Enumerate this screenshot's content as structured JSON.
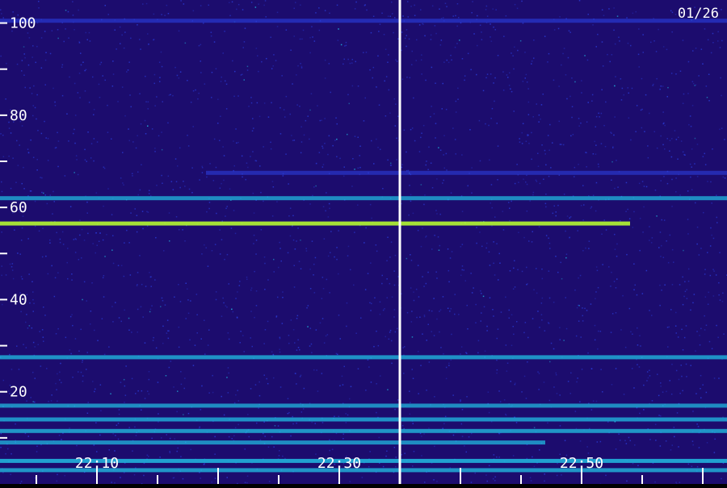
{
  "date_label": "01/26",
  "colors": {
    "background": "#1c0c6e",
    "tick": "#ffffff",
    "label": "#ffffff",
    "weak": "#2a3cd8",
    "medium": "#21c3e6",
    "strong": "#b8ff30",
    "peak": "#ff9a2a"
  },
  "chart_data": {
    "type": "heatmap",
    "title": "",
    "xlabel": "",
    "ylabel": "",
    "x_time_range": [
      "22:02",
      "22:62"
    ],
    "x_ticks": [
      "22:10",
      "22:30",
      "22:50"
    ],
    "y_ticks": [
      20,
      40,
      60,
      80,
      100
    ],
    "ylim": [
      0,
      105
    ],
    "marker_time": "22:35",
    "bands": [
      {
        "y": 56.5,
        "from": "22:02",
        "to": "22:54",
        "intensity": 0.85
      },
      {
        "y": 62.0,
        "from": "22:02",
        "to": "22:62",
        "intensity": 0.5
      },
      {
        "y": 67.5,
        "from": "22:19",
        "to": "22:62",
        "intensity": 0.35
      },
      {
        "y": 27.5,
        "from": "22:02",
        "to": "22:62",
        "intensity": 0.55
      },
      {
        "y": 100.5,
        "from": "22:02",
        "to": "22:62",
        "intensity": 0.4
      },
      {
        "y": 17.0,
        "from": "22:02",
        "to": "22:62",
        "intensity": 0.5
      },
      {
        "y": 14.0,
        "from": "22:02",
        "to": "22:62",
        "intensity": 0.55
      },
      {
        "y": 11.5,
        "from": "22:02",
        "to": "22:62",
        "intensity": 0.6
      },
      {
        "y": 9.0,
        "from": "22:02",
        "to": "22:47",
        "intensity": 0.5
      },
      {
        "y": 5.0,
        "from": "22:02",
        "to": "22:62",
        "intensity": 0.75
      },
      {
        "y": 3.0,
        "from": "22:02",
        "to": "22:62",
        "intensity": 0.6
      }
    ]
  }
}
